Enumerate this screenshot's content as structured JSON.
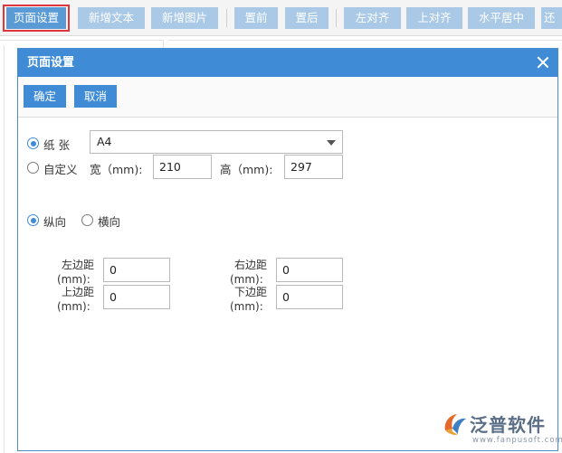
{
  "toolbar": {
    "buttons": [
      {
        "label": "页面设置"
      },
      {
        "label": "新增文本"
      },
      {
        "label": "新增图片"
      },
      {
        "label": "置前"
      },
      {
        "label": "置后"
      },
      {
        "label": "左对齐"
      },
      {
        "label": "上对齐"
      },
      {
        "label": "水平居中"
      },
      {
        "label": "还"
      }
    ]
  },
  "dialog": {
    "title": "页面设置",
    "confirm_label": "确定",
    "cancel_label": "取消",
    "paper": {
      "radio_label": "纸 张",
      "selected": "A4"
    },
    "custom": {
      "radio_label": "自定义",
      "width_label": "宽（mm):",
      "width_value": "210",
      "height_label": "高（mm):",
      "height_value": "297"
    },
    "orientation": {
      "portrait_label": "纵向",
      "landscape_label": "横向",
      "selected": "portrait"
    },
    "margins": {
      "left_label_1": "左边距",
      "left_label_2": "(mm):",
      "left_value": "0",
      "top_label_1": "上边距",
      "top_label_2": "(mm):",
      "top_value": "0",
      "right_label_1": "右边距",
      "right_label_2": "(mm):",
      "right_value": "0",
      "bottom_label_1": "下边距",
      "bottom_label_2": "(mm):",
      "bottom_value": "0"
    }
  },
  "watermark": {
    "brand": "泛普软件",
    "url": "www.fanpusoft.com"
  },
  "colors": {
    "accent": "#3f8bd6",
    "toolbar_button": "#a9c9e6",
    "highlight": "#e0353b"
  }
}
